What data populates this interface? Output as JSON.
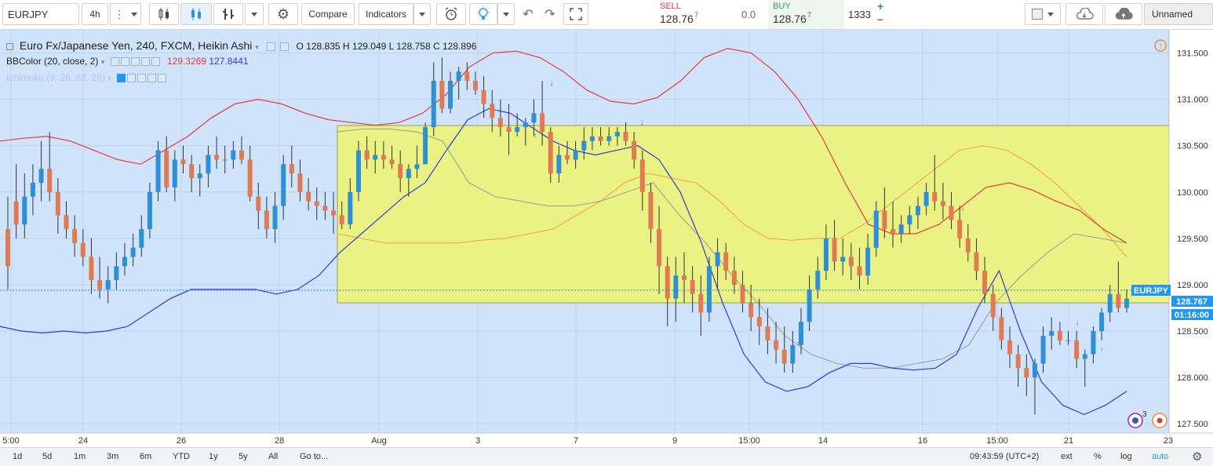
{
  "toolbar": {
    "symbol": "EURJPY",
    "interval": "4h",
    "compare_label": "Compare",
    "indicators_label": "Indicators",
    "layout_name": "Unnamed"
  },
  "trade": {
    "sell_label": "SELL",
    "sell_price": "128.76",
    "sell_sup": "7",
    "spread": "0.0",
    "buy_label": "BUY",
    "buy_price": "128.76",
    "buy_sup": "7",
    "quantity": "1333",
    "plus": "+",
    "minus": "–"
  },
  "legend": {
    "title": "Euro Fx/Japanese Yen, 240, FXCM, Heikin Ashi",
    "ohlc": {
      "o_label": "O",
      "o": "128.835",
      "h_label": "H",
      "h": "129.049",
      "l_label": "L",
      "l": "128.758",
      "c_label": "C",
      "c": "128.896"
    },
    "bb_name": "BBColor (20, close, 2)",
    "bb_upper": "129.3269",
    "bb_lower": "127.8441",
    "ichimoku_name": "Ichimoku (9, 26, 52, 26)"
  },
  "price_axis": {
    "ticks": [
      "131.500",
      "131.000",
      "130.500",
      "130.000",
      "129.500",
      "129.000",
      "128.500",
      "128.000",
      "127.500"
    ],
    "symbol_tag": "EURJPY",
    "last_price": "128.767",
    "countdown": "01:16:00"
  },
  "time_axis": {
    "labels": [
      "5:00",
      "24",
      "26",
      "28",
      "Aug",
      "3",
      "7",
      "9",
      "15:00",
      "14",
      "16",
      "15:00",
      "21",
      "23"
    ]
  },
  "bottom": {
    "ranges": [
      "1d",
      "5d",
      "1m",
      "3m",
      "6m",
      "YTD",
      "1y",
      "5y",
      "All"
    ],
    "goto": "Go to...",
    "clock": "09:43:59 (UTC+2)",
    "ext": "ext",
    "percent": "%",
    "log": "log",
    "auto": "auto"
  },
  "badges": {
    "events_count": "3"
  },
  "colors": {
    "background": "#cfe3fb",
    "rect_fill": "#eef37a",
    "up_candle": "#2e8fd6",
    "down_candle": "#e07a52",
    "bb_upper_line": "#e53b3b",
    "bb_lower_line": "#2f3bd6",
    "ichimoku_line": "#f0a040",
    "accent": "#2196f3"
  },
  "chart_data": {
    "type": "candlestick",
    "title": "Euro Fx/Japanese Yen, 240, FXCM, Heikin Ashi",
    "ylim": [
      127.4,
      131.75
    ],
    "candles": [
      [
        129.6,
        129.95,
        128.95,
        129.2
      ],
      [
        129.9,
        130.3,
        129.5,
        129.65
      ],
      [
        129.65,
        130.2,
        129.5,
        129.95
      ],
      [
        129.95,
        130.3,
        129.75,
        130.1
      ],
      [
        130.1,
        130.55,
        129.9,
        130.25
      ],
      [
        130.25,
        130.65,
        129.9,
        130.0
      ],
      [
        130.0,
        130.15,
        129.55,
        129.75
      ],
      [
        129.75,
        129.9,
        129.5,
        129.6
      ],
      [
        129.6,
        129.75,
        129.3,
        129.45
      ],
      [
        129.45,
        129.6,
        129.2,
        129.3
      ],
      [
        129.3,
        129.5,
        128.9,
        129.05
      ],
      [
        129.05,
        129.3,
        128.85,
        128.95
      ],
      [
        128.95,
        129.2,
        128.8,
        129.05
      ],
      [
        129.05,
        129.35,
        128.95,
        129.2
      ],
      [
        129.2,
        129.45,
        129.1,
        129.3
      ],
      [
        129.3,
        129.55,
        129.2,
        129.4
      ],
      [
        129.4,
        129.75,
        129.3,
        129.6
      ],
      [
        129.6,
        130.1,
        129.5,
        130.0
      ],
      [
        130.0,
        130.55,
        129.9,
        130.45
      ],
      [
        130.45,
        130.6,
        130.0,
        130.05
      ],
      [
        130.05,
        130.45,
        129.9,
        130.35
      ],
      [
        130.35,
        130.5,
        130.2,
        130.3
      ],
      [
        130.3,
        130.4,
        130.0,
        130.15
      ],
      [
        130.15,
        130.3,
        129.95,
        130.2
      ],
      [
        130.2,
        130.5,
        130.05,
        130.4
      ],
      [
        130.4,
        130.6,
        130.25,
        130.35
      ],
      [
        130.35,
        130.5,
        130.2,
        130.35
      ],
      [
        130.35,
        130.55,
        130.25,
        130.45
      ],
      [
        130.45,
        130.6,
        130.3,
        130.35
      ],
      [
        130.35,
        130.5,
        129.9,
        129.95
      ],
      [
        129.95,
        130.1,
        129.6,
        129.8
      ],
      [
        129.8,
        129.95,
        129.5,
        129.6
      ],
      [
        129.6,
        130.0,
        129.45,
        129.85
      ],
      [
        129.85,
        130.4,
        129.7,
        130.3
      ],
      [
        130.3,
        130.5,
        130.05,
        130.2
      ],
      [
        130.2,
        130.35,
        129.9,
        130.0
      ],
      [
        130.0,
        130.15,
        129.8,
        129.9
      ],
      [
        129.9,
        130.05,
        129.7,
        129.85
      ],
      [
        129.85,
        130.0,
        129.7,
        129.8
      ],
      [
        129.8,
        130.0,
        129.55,
        129.75
      ],
      [
        129.75,
        129.9,
        129.6,
        129.65
      ],
      [
        129.65,
        130.15,
        129.6,
        130.0
      ],
      [
        130.0,
        130.55,
        129.9,
        130.45
      ],
      [
        130.45,
        130.6,
        130.25,
        130.35
      ],
      [
        130.35,
        130.55,
        130.2,
        130.4
      ],
      [
        130.4,
        130.55,
        130.25,
        130.35
      ],
      [
        130.35,
        130.5,
        130.25,
        130.3
      ],
      [
        130.3,
        130.45,
        130.0,
        130.15
      ],
      [
        130.15,
        130.3,
        129.95,
        130.25
      ],
      [
        130.25,
        130.5,
        130.15,
        130.3
      ],
      [
        130.3,
        130.75,
        130.3,
        130.7
      ],
      [
        130.7,
        131.4,
        130.6,
        131.2
      ],
      [
        131.2,
        131.45,
        130.85,
        130.9
      ],
      [
        130.9,
        131.3,
        130.85,
        131.2
      ],
      [
        131.2,
        131.35,
        131.0,
        131.3
      ],
      [
        131.3,
        131.4,
        131.1,
        131.2
      ],
      [
        131.2,
        131.3,
        131.05,
        131.1
      ],
      [
        131.1,
        131.25,
        130.8,
        130.95
      ],
      [
        130.95,
        131.1,
        130.65,
        130.8
      ],
      [
        130.8,
        131.0,
        130.6,
        130.7
      ],
      [
        130.7,
        130.95,
        130.4,
        130.65
      ],
      [
        130.65,
        130.85,
        130.6,
        130.7
      ],
      [
        130.7,
        130.8,
        130.5,
        130.75
      ],
      [
        130.75,
        131.0,
        130.6,
        130.85
      ],
      [
        130.85,
        131.2,
        130.5,
        130.65
      ],
      [
        130.65,
        130.7,
        130.1,
        130.2
      ],
      [
        130.2,
        130.5,
        130.1,
        130.4
      ],
      [
        130.4,
        130.55,
        130.3,
        130.35
      ],
      [
        130.35,
        130.55,
        130.25,
        130.45
      ],
      [
        130.45,
        130.7,
        130.35,
        130.55
      ],
      [
        130.55,
        130.7,
        130.45,
        130.6
      ],
      [
        130.6,
        130.7,
        130.5,
        130.55
      ],
      [
        130.55,
        130.7,
        130.5,
        130.6
      ],
      [
        130.6,
        130.7,
        130.5,
        130.65
      ],
      [
        130.65,
        130.75,
        130.5,
        130.55
      ],
      [
        130.55,
        130.65,
        130.25,
        130.35
      ],
      [
        130.35,
        130.45,
        129.8,
        130.0
      ],
      [
        130.0,
        130.1,
        129.45,
        129.6
      ],
      [
        129.6,
        129.85,
        128.9,
        129.2
      ],
      [
        129.2,
        129.3,
        128.55,
        128.85
      ],
      [
        128.85,
        129.3,
        128.6,
        129.1
      ],
      [
        129.1,
        129.35,
        128.8,
        129.05
      ],
      [
        129.05,
        129.2,
        128.7,
        128.9
      ],
      [
        128.9,
        129.1,
        128.45,
        128.7
      ],
      [
        128.7,
        129.3,
        128.6,
        129.2
      ],
      [
        129.2,
        129.5,
        128.95,
        129.35
      ],
      [
        129.35,
        129.45,
        129.05,
        129.15
      ],
      [
        129.15,
        129.3,
        128.9,
        129.0
      ],
      [
        129.0,
        129.15,
        128.7,
        128.8
      ],
      [
        128.8,
        129.0,
        128.5,
        128.65
      ],
      [
        128.65,
        128.85,
        128.35,
        128.55
      ],
      [
        128.55,
        128.75,
        128.25,
        128.4
      ],
      [
        128.4,
        128.6,
        128.15,
        128.3
      ],
      [
        128.3,
        128.55,
        128.05,
        128.15
      ],
      [
        128.15,
        128.5,
        128.05,
        128.35
      ],
      [
        128.35,
        128.75,
        128.25,
        128.6
      ],
      [
        128.6,
        129.1,
        128.5,
        128.95
      ],
      [
        128.95,
        129.3,
        128.85,
        129.15
      ],
      [
        129.15,
        129.65,
        129.05,
        129.5
      ],
      [
        129.5,
        129.7,
        129.15,
        129.25
      ],
      [
        129.25,
        129.5,
        129.1,
        129.3
      ],
      [
        129.3,
        129.45,
        129.05,
        129.2
      ],
      [
        129.2,
        129.4,
        128.95,
        129.1
      ],
      [
        129.1,
        129.55,
        129.0,
        129.4
      ],
      [
        129.4,
        129.9,
        129.3,
        129.8
      ],
      [
        129.8,
        130.05,
        129.5,
        129.6
      ],
      [
        129.6,
        129.9,
        129.4,
        129.55
      ],
      [
        129.55,
        129.75,
        129.45,
        129.65
      ],
      [
        129.65,
        129.85,
        129.55,
        129.75
      ],
      [
        129.75,
        129.95,
        129.6,
        129.85
      ],
      [
        129.85,
        130.1,
        129.75,
        130.0
      ],
      [
        130.0,
        130.4,
        129.8,
        129.9
      ],
      [
        129.9,
        130.1,
        129.7,
        129.85
      ],
      [
        129.85,
        130.0,
        129.6,
        129.7
      ],
      [
        129.7,
        129.85,
        129.4,
        129.5
      ],
      [
        129.5,
        129.65,
        129.25,
        129.35
      ],
      [
        129.35,
        129.5,
        129.05,
        129.15
      ],
      [
        129.15,
        129.3,
        128.8,
        128.9
      ],
      [
        128.9,
        129.0,
        128.5,
        128.65
      ],
      [
        128.65,
        128.75,
        128.3,
        128.4
      ],
      [
        128.4,
        128.55,
        128.1,
        128.25
      ],
      [
        128.25,
        128.35,
        127.9,
        128.1
      ],
      [
        128.1,
        128.25,
        127.8,
        128.0
      ],
      [
        128.0,
        128.2,
        127.6,
        128.15
      ],
      [
        128.15,
        128.55,
        128.05,
        128.45
      ],
      [
        128.45,
        128.65,
        128.3,
        128.5
      ],
      [
        128.5,
        128.6,
        128.35,
        128.4
      ],
      [
        128.4,
        128.5,
        128.35,
        128.4
      ],
      [
        128.4,
        128.5,
        128.1,
        128.2
      ],
      [
        128.2,
        128.3,
        127.9,
        128.25
      ],
      [
        128.25,
        128.55,
        128.15,
        128.5
      ],
      [
        128.5,
        128.75,
        128.4,
        128.7
      ],
      [
        128.7,
        129.0,
        128.6,
        128.9
      ],
      [
        128.9,
        129.25,
        128.7,
        128.75
      ],
      [
        128.75,
        128.95,
        128.7,
        128.85
      ]
    ],
    "bb_upper": [
      130.55,
      130.58,
      130.6,
      130.55,
      130.45,
      130.35,
      130.3,
      130.45,
      130.6,
      130.8,
      130.95,
      131.0,
      130.95,
      130.85,
      130.78,
      130.75,
      130.72,
      130.75,
      130.85,
      131.05,
      131.35,
      131.5,
      131.52,
      131.45,
      131.3,
      131.1,
      130.98,
      130.95,
      131.02,
      131.2,
      131.45,
      131.55,
      131.5,
      131.3,
      131.0,
      130.6,
      130.1,
      129.65,
      129.55,
      129.55,
      129.65,
      129.85,
      130.05,
      130.1,
      130.02,
      129.9,
      129.8,
      129.6,
      129.45
    ],
    "bb_lower": [
      128.55,
      128.5,
      128.48,
      128.5,
      128.48,
      128.5,
      128.55,
      128.7,
      128.85,
      128.95,
      128.95,
      128.95,
      128.95,
      128.9,
      128.95,
      129.1,
      129.35,
      129.55,
      129.75,
      129.95,
      130.1,
      130.45,
      130.78,
      130.9,
      130.85,
      130.7,
      130.55,
      130.45,
      130.4,
      130.45,
      130.5,
      130.35,
      130.0,
      129.45,
      128.8,
      128.25,
      127.95,
      127.85,
      127.9,
      128.05,
      128.15,
      128.15,
      128.1,
      128.08,
      128.1,
      128.25,
      128.75,
      129.15,
      128.5,
      127.95,
      127.7,
      127.6,
      127.7,
      127.85
    ]
  }
}
